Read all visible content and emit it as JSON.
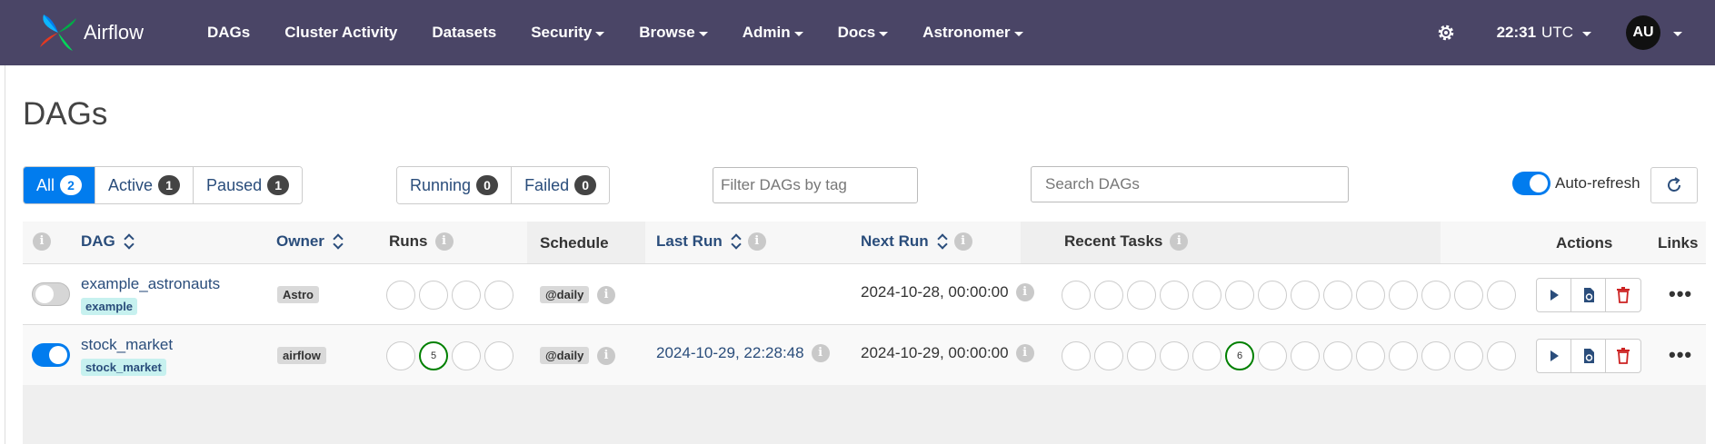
{
  "nav": {
    "brand": "Airflow",
    "items": [
      "DAGs",
      "Cluster Activity",
      "Datasets",
      "Security",
      "Browse",
      "Admin",
      "Docs",
      "Astronomer"
    ],
    "time": "22:31",
    "timezone": "UTC",
    "user_initials": "AU"
  },
  "page": {
    "title": "DAGs"
  },
  "filters": {
    "status": [
      {
        "label": "All",
        "count": "2"
      },
      {
        "label": "Active",
        "count": "1"
      },
      {
        "label": "Paused",
        "count": "1"
      }
    ],
    "run_state": [
      {
        "label": "Running",
        "count": "0"
      },
      {
        "label": "Failed",
        "count": "0"
      }
    ],
    "tag_placeholder": "Filter DAGs by tag",
    "search_placeholder": "Search DAGs",
    "auto_refresh_label": "Auto-refresh"
  },
  "table": {
    "headers": {
      "dag": "DAG",
      "owner": "Owner",
      "runs": "Runs",
      "schedule": "Schedule",
      "last_run": "Last Run",
      "next_run": "Next Run",
      "recent_tasks": "Recent Tasks",
      "actions": "Actions",
      "links": "Links"
    },
    "rows": [
      {
        "dag_id": "example_astronauts",
        "tag": "example",
        "owner": "Astro",
        "paused": true,
        "schedule": "@daily",
        "last_run": "",
        "next_run": "2024-10-28, 00:00:00",
        "runs_success_count": "",
        "tasks_success_count": ""
      },
      {
        "dag_id": "stock_market",
        "tag": "stock_market",
        "owner": "airflow",
        "paused": false,
        "schedule": "@daily",
        "last_run": "2024-10-29, 22:28:48",
        "next_run": "2024-10-29, 00:00:00",
        "runs_success_count": "5",
        "tasks_success_count": "6"
      }
    ]
  },
  "colors": {
    "navbar": "#4a4566",
    "primary": "#017cee",
    "success": "#008000",
    "danger": "#cc2222",
    "link": "#2a4d7b"
  }
}
